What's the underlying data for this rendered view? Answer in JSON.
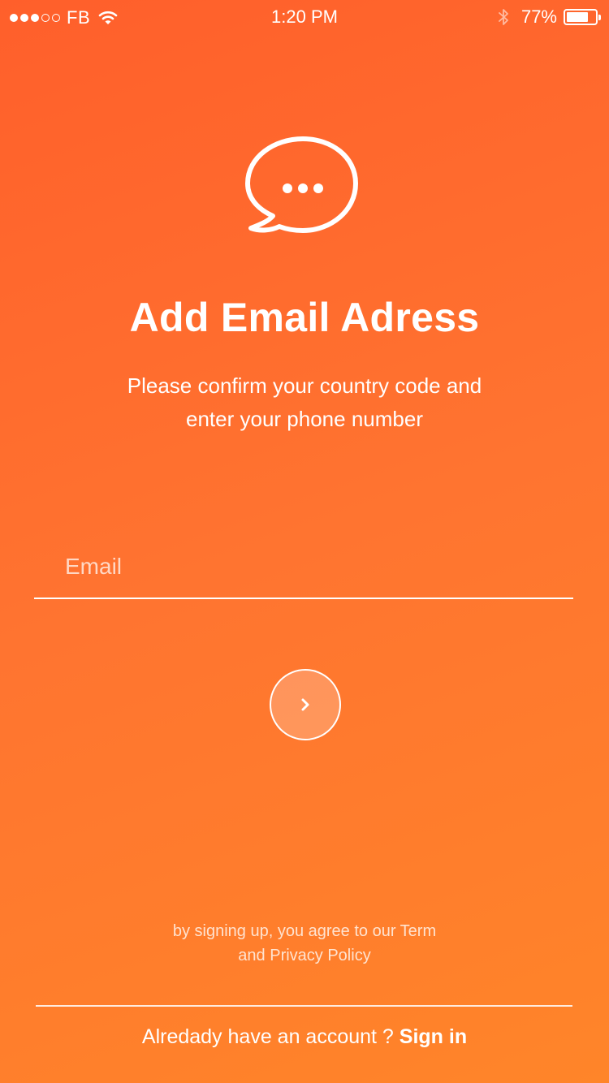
{
  "status_bar": {
    "carrier": "FB",
    "signal_dots_filled": 3,
    "signal_dots_total": 5,
    "time": "1:20 PM",
    "battery_percent": "77%",
    "battery_level": 0.77
  },
  "icons": {
    "chat": "chat-bubble-icon",
    "next": "chevron-right-icon",
    "wifi": "wifi-icon",
    "bluetooth": "bluetooth-icon",
    "battery": "battery-icon"
  },
  "colors": {
    "background_top": "#ff5f2b",
    "background_bottom": "#ff8529",
    "text": "#ffffff"
  },
  "main": {
    "title": "Add Email Adress",
    "subtitle_line1": "Please confirm your country code and",
    "subtitle_line2": "enter your phone number",
    "email_placeholder": "Email",
    "email_value": "",
    "terms_line1": "by signing up, you agree to our Term",
    "terms_line2": "and Privacy Policy"
  },
  "footer": {
    "prompt": "Alredady have an account ? ",
    "signin_label": "Sign in"
  }
}
